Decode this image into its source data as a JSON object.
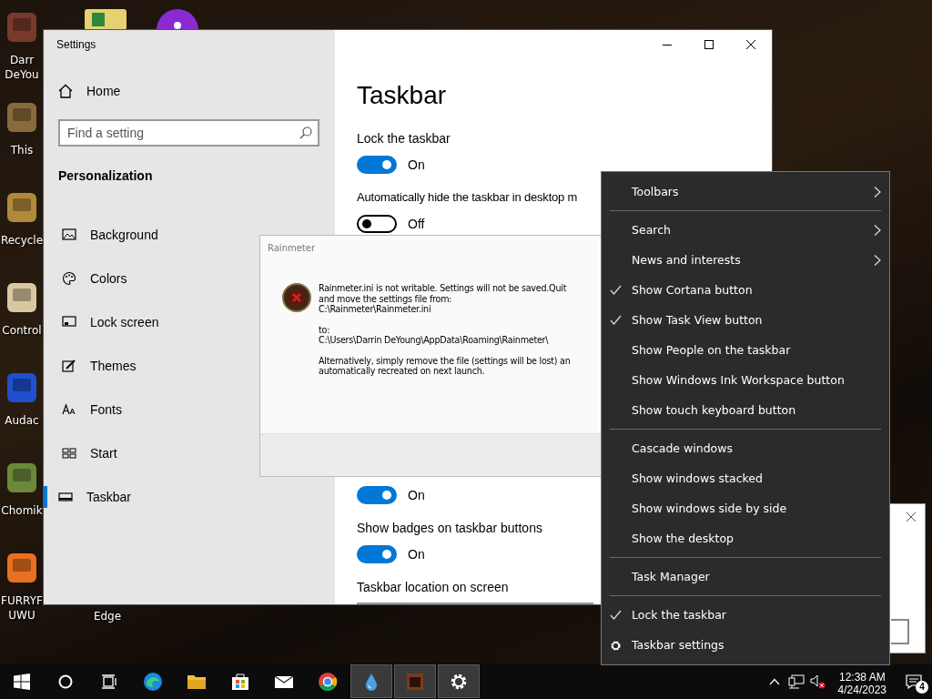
{
  "desktop": {
    "icons": [
      {
        "label": "Darr DeYou"
      },
      {
        "label": "This"
      },
      {
        "label": "Recycle"
      },
      {
        "label": "Control"
      },
      {
        "label": "Audac"
      },
      {
        "label": "Chomik"
      },
      {
        "label": "FURRYF UWU"
      }
    ],
    "second_column_label": "Edge"
  },
  "settings_window": {
    "title": "Settings",
    "home": "Home",
    "search_placeholder": "Find a setting",
    "section": "Personalization",
    "nav": [
      {
        "label": "Background",
        "selected": false
      },
      {
        "label": "Colors",
        "selected": false
      },
      {
        "label": "Lock screen",
        "selected": false
      },
      {
        "label": "Themes",
        "selected": false
      },
      {
        "label": "Fonts",
        "selected": false
      },
      {
        "label": "Start",
        "selected": false
      },
      {
        "label": "Taskbar",
        "selected": true
      }
    ],
    "page_title": "Taskbar",
    "options": [
      {
        "label": "Lock the taskbar",
        "on": true,
        "state_text": "On"
      },
      {
        "label": "Automatically hide the taskbar in desktop m",
        "on": false,
        "state_text": "Off"
      },
      {
        "on": true,
        "state_text": "On"
      },
      {
        "label": "Show badges on taskbar buttons",
        "on": true,
        "state_text": "On"
      }
    ],
    "location_label": "Taskbar location on screen"
  },
  "rainmeter_dialog": {
    "title": "Rainmeter",
    "paragraphs": [
      [
        "Rainmeter.ini is not writable. Settings will not be saved.Quit",
        "and move the settings file from:",
        "C:\\Rainmeter\\Rainmeter.ini"
      ],
      [
        "to:",
        "C:\\Users\\Darrin DeYoung\\AppData\\Roaming\\Rainmeter\\"
      ],
      [
        "Alternatively, simply remove the file (settings will be lost) an",
        "automatically recreated on next launch."
      ]
    ]
  },
  "context_menu": {
    "items": [
      {
        "kind": "item",
        "label": "Toolbars",
        "checked": false,
        "submenu": true
      },
      {
        "kind": "separator"
      },
      {
        "kind": "item",
        "label": "Search",
        "checked": false,
        "submenu": true
      },
      {
        "kind": "item",
        "label": "News and interests",
        "checked": false,
        "submenu": true
      },
      {
        "kind": "item",
        "label": "Show Cortana button",
        "checked": true,
        "submenu": false
      },
      {
        "kind": "item",
        "label": "Show Task View button",
        "checked": true,
        "submenu": false
      },
      {
        "kind": "item",
        "label": "Show People on the taskbar",
        "checked": false,
        "submenu": false
      },
      {
        "kind": "item",
        "label": "Show Windows Ink Workspace button",
        "checked": false,
        "submenu": false
      },
      {
        "kind": "item",
        "label": "Show touch keyboard button",
        "checked": false,
        "submenu": false
      },
      {
        "kind": "separator"
      },
      {
        "kind": "item",
        "label": "Cascade windows",
        "checked": false,
        "submenu": false
      },
      {
        "kind": "item",
        "label": "Show windows stacked",
        "checked": false,
        "submenu": false
      },
      {
        "kind": "item",
        "label": "Show windows side by side",
        "checked": false,
        "submenu": false
      },
      {
        "kind": "item",
        "label": "Show the desktop",
        "checked": false,
        "submenu": false
      },
      {
        "kind": "separator"
      },
      {
        "kind": "item",
        "label": "Task Manager",
        "checked": false,
        "submenu": false
      },
      {
        "kind": "separator"
      },
      {
        "kind": "item",
        "label": "Lock the taskbar",
        "checked": true,
        "submenu": false
      },
      {
        "kind": "gear_item",
        "label": "Taskbar settings"
      }
    ]
  },
  "taskbar": {
    "apps": [
      {
        "active": false
      },
      {
        "active": false
      },
      {
        "active": false
      },
      {
        "active": false
      },
      {
        "active": false
      },
      {
        "active": true
      },
      {
        "active": true
      },
      {
        "active": true
      }
    ],
    "time": "12:38 AM",
    "date": "4/24/2023",
    "notification_count": "4"
  }
}
